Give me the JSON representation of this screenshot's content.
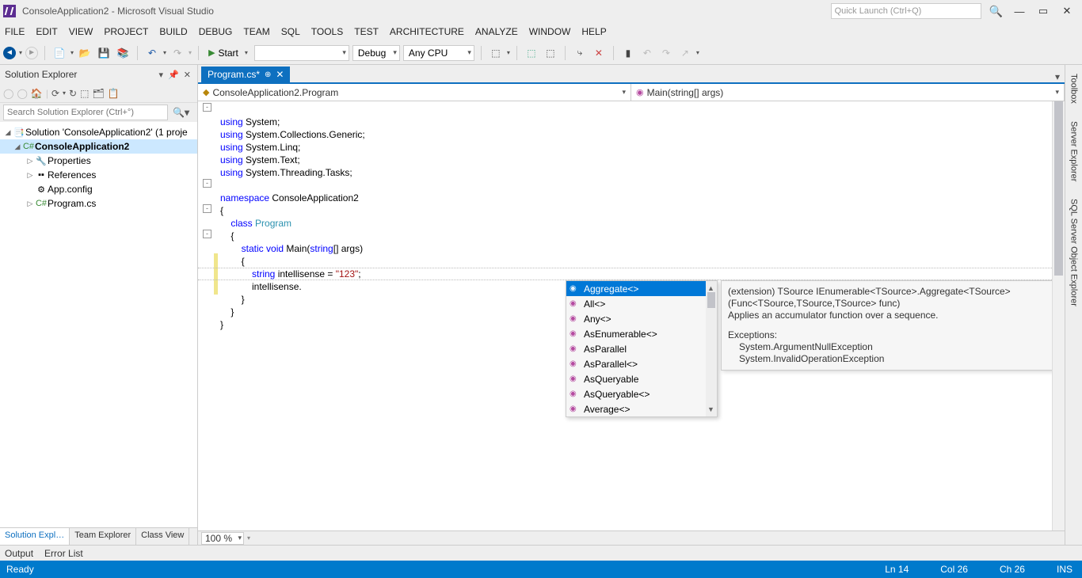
{
  "title_bar": {
    "title": "ConsoleApplication2 - Microsoft Visual Studio",
    "quick_launch_placeholder": "Quick Launch (Ctrl+Q)"
  },
  "menu": {
    "file": "FILE",
    "edit": "EDIT",
    "view": "VIEW",
    "project": "PROJECT",
    "build": "BUILD",
    "debug": "DEBUG",
    "team": "TEAM",
    "sql": "SQL",
    "tools": "TOOLS",
    "test": "TEST",
    "architecture": "ARCHITECTURE",
    "analyze": "ANALYZE",
    "window": "WINDOW",
    "help": "HELP"
  },
  "toolbar": {
    "start": "Start",
    "config": "Debug",
    "platform": "Any CPU"
  },
  "solution_explorer": {
    "title": "Solution Explorer",
    "search_placeholder": "Search Solution Explorer (Ctrl+°)",
    "solution": "Solution 'ConsoleApplication2' (1 proje",
    "project": "ConsoleApplication2",
    "properties": "Properties",
    "references": "References",
    "appconfig": "App.config",
    "programcs": "Program.cs",
    "tab_solution": "Solution Expl…",
    "tab_team": "Team Explorer",
    "tab_class": "Class View"
  },
  "editor": {
    "tab": "Program.cs*",
    "nav_left": "ConsoleApplication2.Program",
    "nav_right": "Main(string[] args)",
    "zoom": "100 %"
  },
  "code": {
    "l1a": "using",
    "l1b": " System;",
    "l2a": "using",
    "l2b": " System.Collections.Generic;",
    "l3a": "using",
    "l3b": " System.Linq;",
    "l4a": "using",
    "l4b": " System.Text;",
    "l5a": "using",
    "l5b": " System.Threading.Tasks;",
    "l7a": "namespace",
    "l7b": " ConsoleApplication2",
    "l8": "{",
    "l9a": "    ",
    "l9b": "class",
    "l9c": " ",
    "l9d": "Program",
    "l10": "    {",
    "l11a": "        ",
    "l11b": "static",
    "l11c": " ",
    "l11d": "void",
    "l11e": " Main(",
    "l11f": "string",
    "l11g": "[] args)",
    "l12": "        {",
    "l13a": "            ",
    "l13b": "string",
    "l13c": " intellisense = ",
    "l13d": "\"123\"",
    "l13e": ";",
    "l14": "            intellisense.",
    "l15": "        }",
    "l16": "    }",
    "l17": "}"
  },
  "intellisense": {
    "items": [
      "Aggregate<>",
      "All<>",
      "Any<>",
      "AsEnumerable<>",
      "AsParallel",
      "AsParallel<>",
      "AsQueryable",
      "AsQueryable<>",
      "Average<>"
    ]
  },
  "tooltip": {
    "sig": "(extension) TSource IEnumerable<TSource>.Aggregate<TSource>(Func<TSource,TSource,TSource> func)",
    "desc": "Applies an accumulator function over a sequence.",
    "exc_h": "Exceptions:",
    "exc1": "System.ArgumentNullException",
    "exc2": "System.InvalidOperationException"
  },
  "right_tabs": {
    "toolbox": "Toolbox",
    "server": "Server Explorer",
    "sql": "SQL Server Object Explorer"
  },
  "bottom": {
    "output": "Output",
    "errors": "Error List"
  },
  "status": {
    "ready": "Ready",
    "ln": "Ln 14",
    "col": "Col 26",
    "ch": "Ch 26",
    "ins": "INS"
  }
}
